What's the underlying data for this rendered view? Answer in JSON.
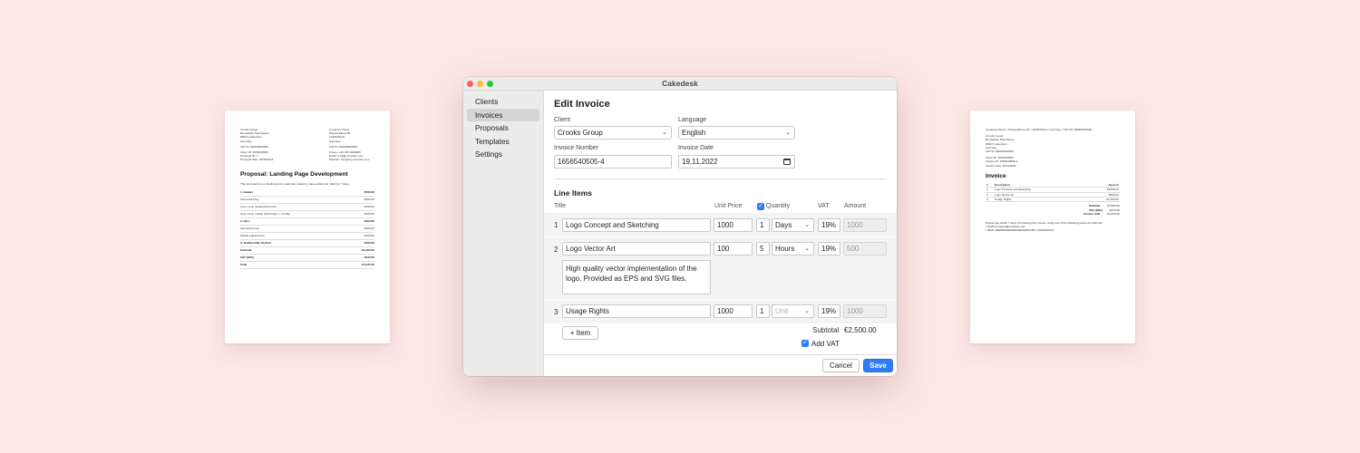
{
  "proposal_doc": {
    "from": [
      "Crooks Group",
      "Bernadette Moonbeam",
      "89027 Lakeshore",
      "Germany"
    ],
    "from_vat": "VAT ID: DE000000000",
    "to": [
      "Company Name",
      "Streetaddress 81",
      "12345 Berlin",
      "Germany"
    ],
    "to_vat": "VAT ID: DE000000000",
    "meta_left": [
      "Client ID: 1656540505",
      "Proposal ID: 7",
      "Proposal date: 29/09/2023"
    ],
    "meta_right": [
      "Phone: +49 150 1000000",
      "Email: mail@company.com",
      "Website: company.example.com"
    ],
    "title": "Proposal: Landing Page Development",
    "intro": "This proposal is non-binding and is valid plus statutory value added tax. Valid for 7 days.",
    "lines": [
      {
        "label": "1. Header",
        "value": "€500.00",
        "section": true
      },
      {
        "label": "Gamestorming",
        "value": "€250.00"
      },
      {
        "label": "User menu desktop/proposal",
        "value": "€100.00"
      },
      {
        "label": "User menu mobile (hamburger + modal)",
        "value": "€150.00"
      },
      {
        "label": "2. Hero",
        "value": "€400.00",
        "section": true
      },
      {
        "label": "Gamestorming",
        "value": "€300.00"
      },
      {
        "label": "Mobile adjustments",
        "value": "€100.00"
      },
      {
        "label": "3. Testimonials Section",
        "value": "€400.00",
        "section": true
      },
      {
        "label": "Subtotal",
        "value": "€1,300.00",
        "section": true
      },
      {
        "label": "VAT (19%)",
        "value": "€247.00",
        "section": true
      },
      {
        "label": "Total",
        "value": "€1,547.00",
        "section": true
      }
    ]
  },
  "invoice_doc": {
    "sender_line": "Company Name / Streetaddress 81 / 12345 Berlin / Germany / VAT ID: DE000000000",
    "client": [
      "Crooks Group",
      "Bernadette Moonbeam",
      "89027 Lakeshore",
      "Germany",
      "VAT ID: DE000000000"
    ],
    "meta": [
      "Client ID: 1656540505",
      "Invoice ID: 1656540505-4",
      "Invoice date: 19/11/2022"
    ],
    "title": "Invoice",
    "headers": [
      "#",
      "Description",
      "Amount"
    ],
    "rows": [
      {
        "n": "1",
        "desc": "Logo Concept and Sketching",
        "amt": "€1000.00"
      },
      {
        "n": "2",
        "desc": "Logo Vector Art",
        "amt": "€500.00"
      },
      {
        "n": "3",
        "desc": "Usage Rights",
        "amt": "€1,000.00"
      }
    ],
    "totals": [
      {
        "label": "Subtotal",
        "value": "€2,500.00"
      },
      {
        "label": "VAT (19%)",
        "value": "€475.00"
      },
      {
        "label": "Invoice total",
        "value": "€2,975.00"
      }
    ],
    "payment_note": "Please pay within 7 days of receiving this invoice using one of the following payment methods:",
    "payment_methods": [
      "• PayPal: paypal@example.com",
      "• IBAN: DE00000000000000000000 BIC: 0000000XXX"
    ]
  },
  "window": {
    "title": "Cakedesk",
    "traffic": {
      "close": "#ff5f57",
      "minimize": "#febc2e",
      "maximize": "#28c840"
    }
  },
  "sidebar": {
    "items": [
      {
        "label": "Clients",
        "active": false
      },
      {
        "label": "Invoices",
        "active": true
      },
      {
        "label": "Proposals",
        "active": false
      },
      {
        "label": "Templates",
        "active": false
      },
      {
        "label": "Settings",
        "active": false
      }
    ]
  },
  "form": {
    "title": "Edit Invoice",
    "client_label": "Client",
    "client_value": "Crooks Group",
    "language_label": "Language",
    "language_value": "English",
    "invoice_number_label": "Invoice Number",
    "invoice_number_value": "1656540505-4",
    "invoice_date_label": "Invoice Date",
    "invoice_date_value": "19.11.2022"
  },
  "line_items": {
    "title": "Line Items",
    "headers": {
      "title": "Title",
      "unit_price": "Unit Price",
      "quantity": "Quantity",
      "vat": "VAT",
      "amount": "Amount"
    },
    "quantity_checked": true,
    "rows": [
      {
        "num": "1",
        "title": "Logo Concept and Sketching",
        "unit_price": "1000",
        "quantity": "1",
        "unit": "Days",
        "vat": "19%",
        "amount": "1000",
        "description": ""
      },
      {
        "num": "2",
        "title": "Logo Vector Art",
        "unit_price": "100",
        "quantity": "5",
        "unit": "Hours",
        "vat": "19%",
        "amount": "500",
        "description": "High quality vector implementation of the logo. Provided as EPS and SVG files."
      },
      {
        "num": "3",
        "title": "Usage Rights",
        "unit_price": "1000",
        "quantity": "1",
        "unit": "",
        "unit_placeholder": "Unit",
        "vat": "19%",
        "amount": "1000",
        "description": ""
      }
    ],
    "add_item_label": "+ Item",
    "subtotal_label": "Subtotal",
    "subtotal_value": "€2,500.00",
    "add_vat_label": "Add VAT",
    "add_vat_checked": true
  },
  "footer": {
    "cancel_label": "Cancel",
    "save_label": "Save"
  },
  "colors": {
    "accent": "#2f7cf6",
    "background": "#fde8e5"
  }
}
